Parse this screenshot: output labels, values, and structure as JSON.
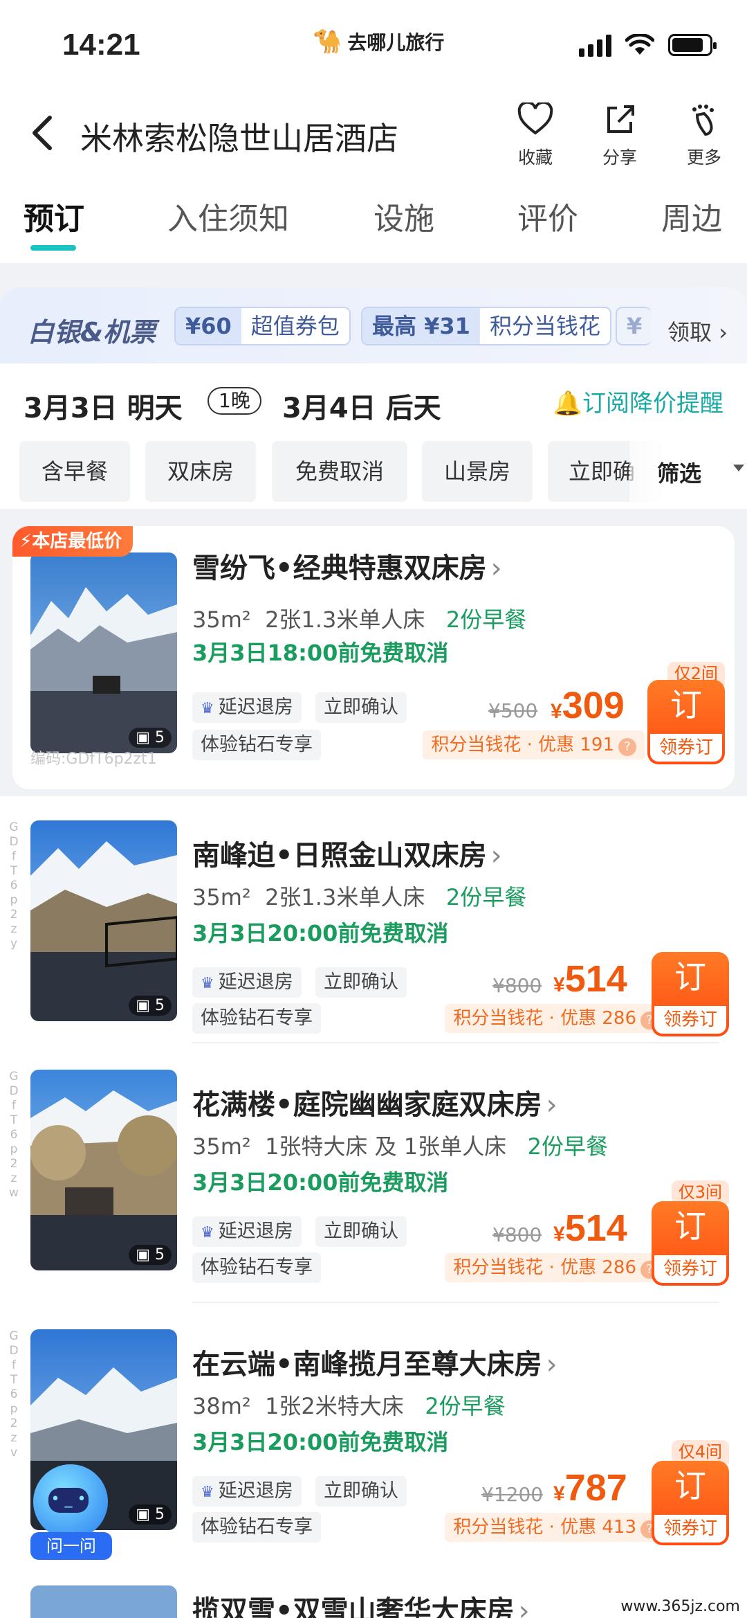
{
  "status": {
    "time": "14:21",
    "brand": "去哪儿旅行"
  },
  "header": {
    "title": "米林索松隐世山居酒店",
    "actions": [
      {
        "icon": "heart-icon",
        "label": "收藏"
      },
      {
        "icon": "share-icon",
        "label": "分享"
      },
      {
        "icon": "footprint-icon",
        "label": "更多"
      }
    ]
  },
  "tabs": [
    "预订",
    "入住须知",
    "设施",
    "评价",
    "周边"
  ],
  "promo": {
    "label": "白银&机票",
    "chips": [
      {
        "a": "¥60",
        "b": "超值券包"
      },
      {
        "a": "最高 ¥31",
        "b": "积分当钱花"
      }
    ],
    "partial": "¥",
    "claim": "领取"
  },
  "dates": {
    "checkin": "3月3日 明天",
    "nights": "1晚",
    "checkout": "3月4日 后天",
    "remind": "订阅降价提醒"
  },
  "filters": [
    "含早餐",
    "双床房",
    "免费取消",
    "山景房",
    "立即确"
  ],
  "screen_label": "筛选",
  "lowest_badge": "本店最低价",
  "rooms": [
    {
      "name": "雪纷飞•经典特惠双床房",
      "area": "35m²",
      "bed": "2张1.3米单人床",
      "breakfast": "2份早餐",
      "cancel": "3月3日18:00前免费取消",
      "tags": [
        "延迟退房",
        "立即确认",
        "体验钻石专享"
      ],
      "orig": "¥500",
      "price": "309",
      "points": "积分当钱花 · 优惠 191",
      "only": "仅2间",
      "photos": "5",
      "code": "编码:GDfT6p2zt1"
    },
    {
      "name": "南峰迫•日照金山双床房",
      "area": "35m²",
      "bed": "2张1.3米单人床",
      "breakfast": "2份早餐",
      "cancel": "3月3日20:00前免费取消",
      "tags": [
        "延迟退房",
        "立即确认",
        "体验钻石专享"
      ],
      "orig": "¥800",
      "price": "514",
      "points": "积分当钱花 · 优惠 286",
      "only": "",
      "photos": "5",
      "code": "GDfT6p2zy"
    },
    {
      "name": "花满楼•庭院幽幽家庭双床房",
      "area": "35m²",
      "bed": "1张特大床 及 1张单人床",
      "breakfast": "2份早餐",
      "cancel": "3月3日20:00前免费取消",
      "tags": [
        "延迟退房",
        "立即确认",
        "体验钻石专享"
      ],
      "orig": "¥800",
      "price": "514",
      "points": "积分当钱花 · 优惠 286",
      "only": "仅3间",
      "photos": "5",
      "code": "GDfT6p2zw"
    },
    {
      "name": "在云端•南峰揽月至尊大床房",
      "area": "38m²",
      "bed": "1张2米特大床",
      "breakfast": "2份早餐",
      "cancel": "3月3日20:00前免费取消",
      "tags": [
        "延迟退房",
        "立即确认",
        "体验钻石专享"
      ],
      "orig": "¥1200",
      "price": "787",
      "points": "积分当钱花 · 优惠 413",
      "only": "仅4间",
      "photos": "5",
      "code": "GDfT6p2zv"
    }
  ],
  "book_label": "订",
  "coupon_label": "领券订",
  "currency": "¥",
  "next_room": "揽双雪•双雪山奢华大床房",
  "ask": "问一问",
  "watermark": "www.365jz.com",
  "colors": {
    "accent": "#18c3c1",
    "price": "#f05a0e",
    "green": "#1a9c5f"
  }
}
